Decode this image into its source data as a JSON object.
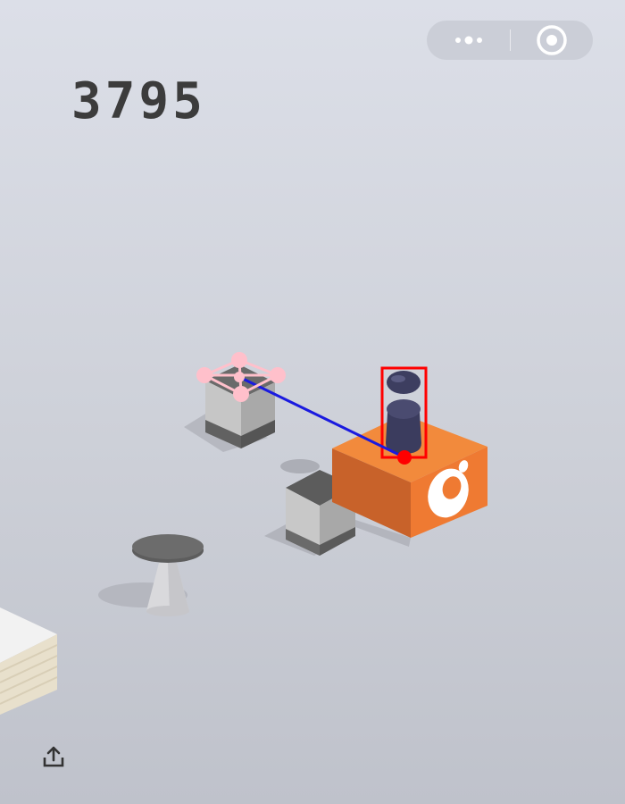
{
  "hud": {
    "score": "3795",
    "menu_icon": "more-dots-icon",
    "close_icon": "target-circle-icon",
    "share_icon": "share-upload-icon"
  },
  "colors": {
    "platform_orange": "#ef7a32",
    "player": "#3b3c5e",
    "trajectory_line": "#1a1adf",
    "target_marker": "#ffc0cb",
    "highlight_box": "#ff0000"
  }
}
